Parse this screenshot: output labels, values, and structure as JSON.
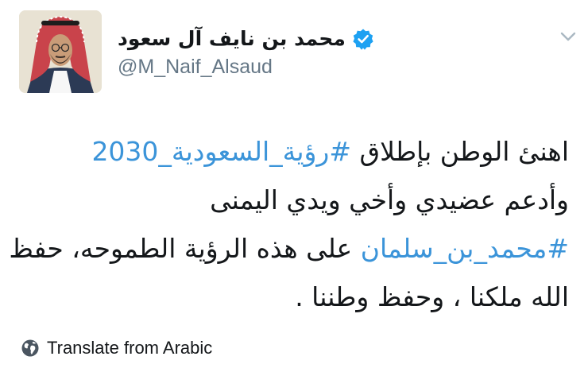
{
  "author": {
    "display_name": "محمد بن نايف آل سعود",
    "handle": "@M_Naif_Alsaud",
    "verified": true
  },
  "tweet": {
    "line1_text": "اهنئ الوطن بإطلاق ",
    "line1_hashtag": "#رؤية_السعودية_2030",
    "line2_text": "وأدعم عضيدي وأخي ويدي اليمنى",
    "line3_hashtag": "#محمد_بن_سلمان",
    "line3_text": " على هذه الرؤية الطموحه، حفظ",
    "line4_text": "الله ملكنا ، وحفظ وطننا ."
  },
  "translate": {
    "label": "Translate from Arabic"
  },
  "colors": {
    "link": "#3b94d9",
    "verified_badge": "#1da1f2",
    "secondary_text": "#657786"
  }
}
